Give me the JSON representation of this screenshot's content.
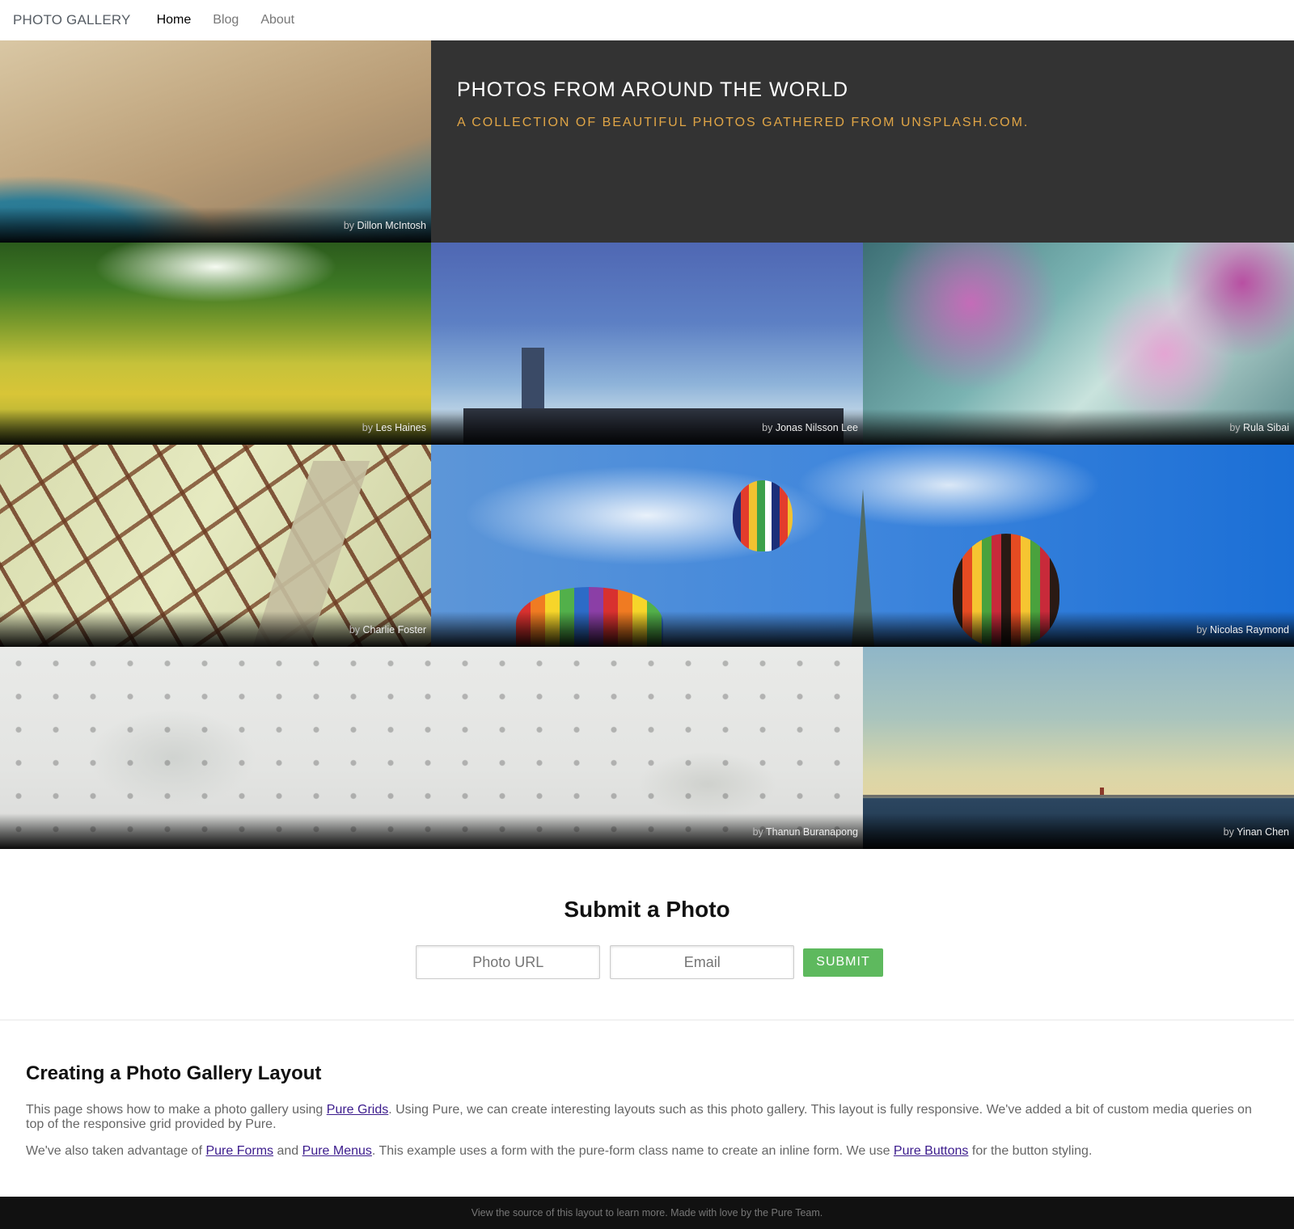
{
  "menu": {
    "brand": "PHOTO GALLERY",
    "items": [
      {
        "label": "Home",
        "selected": true
      },
      {
        "label": "Blog",
        "selected": false
      },
      {
        "label": "About",
        "selected": false
      }
    ]
  },
  "hero": {
    "title": "Photos from around the world",
    "subtitle": "A collection of beautiful photos gathered from unsplash.com."
  },
  "gallery": {
    "by": "by",
    "photos": [
      {
        "author": "Dillon McIntosh"
      },
      {
        "author": "Les Haines"
      },
      {
        "author": "Jonas Nilsson Lee"
      },
      {
        "author": "Rula Sibai"
      },
      {
        "author": "Charlie Foster"
      },
      {
        "author": "Nicolas Raymond"
      },
      {
        "author": "Thanun Buranapong"
      },
      {
        "author": "Yinan Chen"
      }
    ]
  },
  "submit": {
    "title": "Submit a Photo",
    "url_placeholder": "Photo URL",
    "email_placeholder": "Email",
    "button_label": "Submit"
  },
  "article": {
    "title": "Creating a Photo Gallery Layout",
    "p1_before": "This page shows how to make a photo gallery using ",
    "p1_link": "Pure Grids",
    "p1_after": ". Using Pure, we can create interesting layouts such as this photo gallery. This layout is fully responsive. We've added a bit of custom media queries on top of the responsive grid provided by Pure.",
    "p2_before": "We've also taken advantage of ",
    "p2_link1": "Pure Forms",
    "p2_mid1": " and ",
    "p2_link2": "Pure Menus",
    "p2_mid2": ". This example uses a form with the pure-form class name to create an inline form. We use ",
    "p2_link3": "Pure Buttons",
    "p2_after": " for the button styling."
  },
  "footer": {
    "text": "View the source of this layout to learn more. Made with love by the Pure Team."
  },
  "colors": {
    "hero_bg": "#333333",
    "hero_subtitle": "#e0a546",
    "submit_button": "#5eb95e",
    "footer_bg": "#111111"
  }
}
